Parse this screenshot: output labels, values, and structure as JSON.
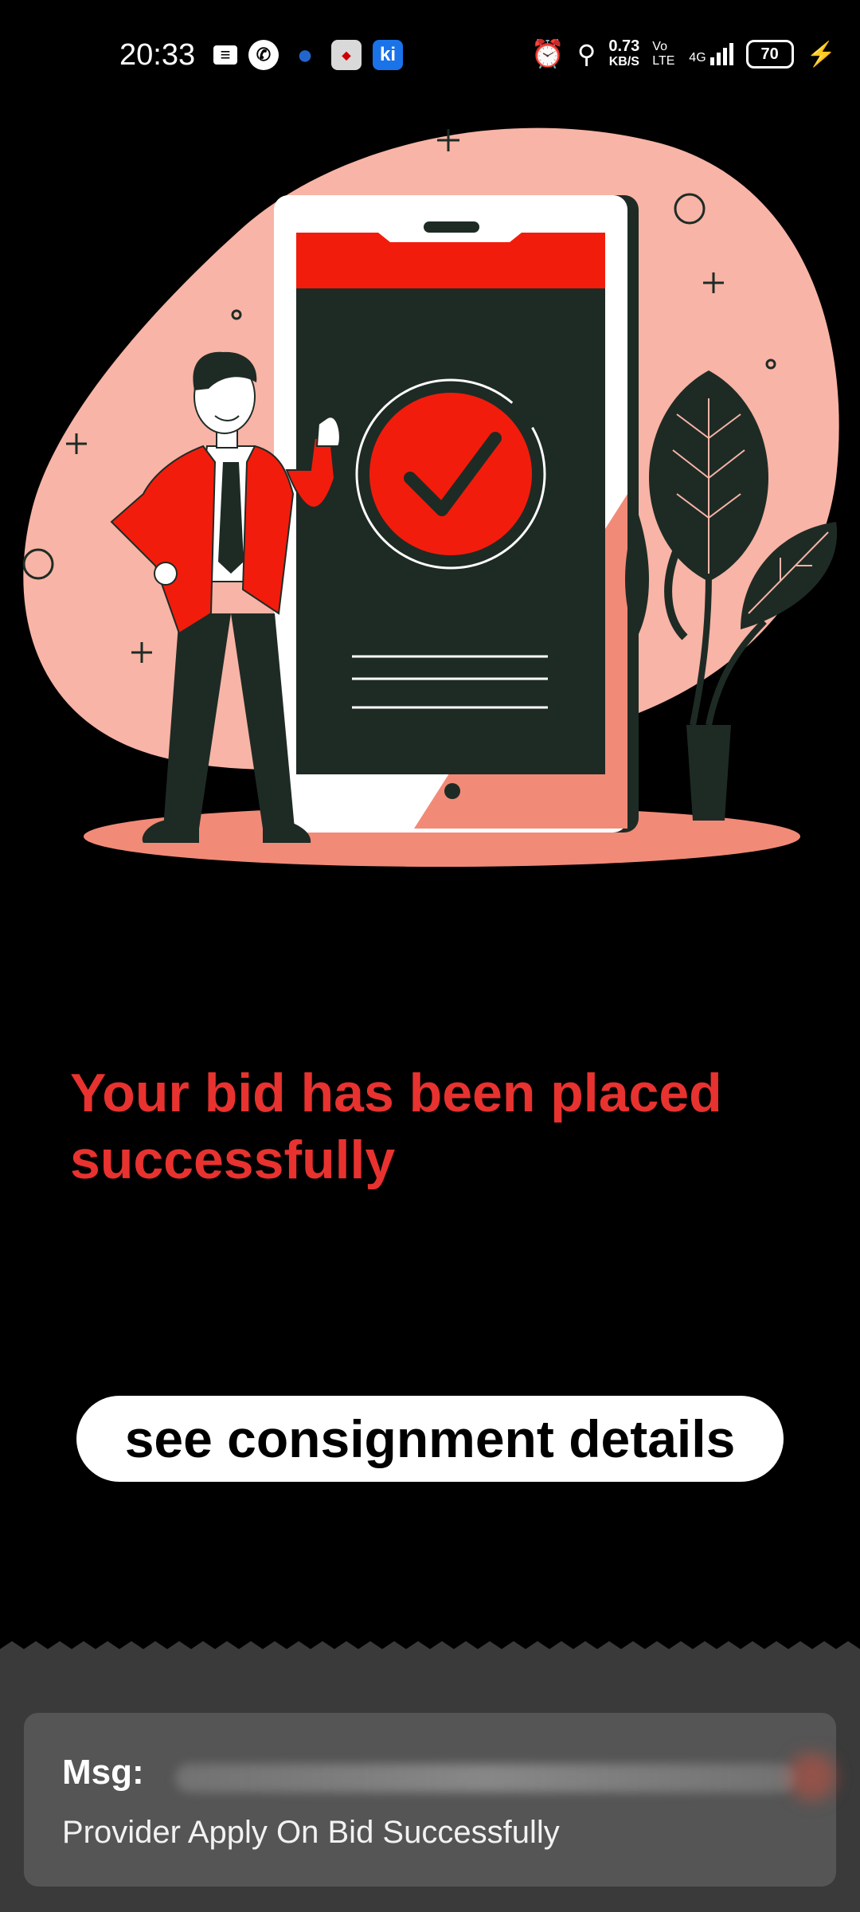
{
  "status_bar": {
    "time": "20:33",
    "left_icons": [
      "message-icon",
      "call-icon",
      "bag-icon",
      "game-app-icon",
      "ki-app-icon"
    ],
    "ki_label": "ki",
    "net_speed_value": "0.73",
    "net_speed_unit": "KB/S",
    "volte": "Vo LTE",
    "network": "4G",
    "battery": "70"
  },
  "main": {
    "headline": "Your bid has been placed successfully",
    "button_label": "see consignment details"
  },
  "toast": {
    "title": "Msg:",
    "message": "Provider Apply On Bid Successfully"
  },
  "colors": {
    "accent_red": "#e8322f",
    "illustration_pink": "#f8b4a6",
    "illustration_dark": "#1e2b25"
  }
}
